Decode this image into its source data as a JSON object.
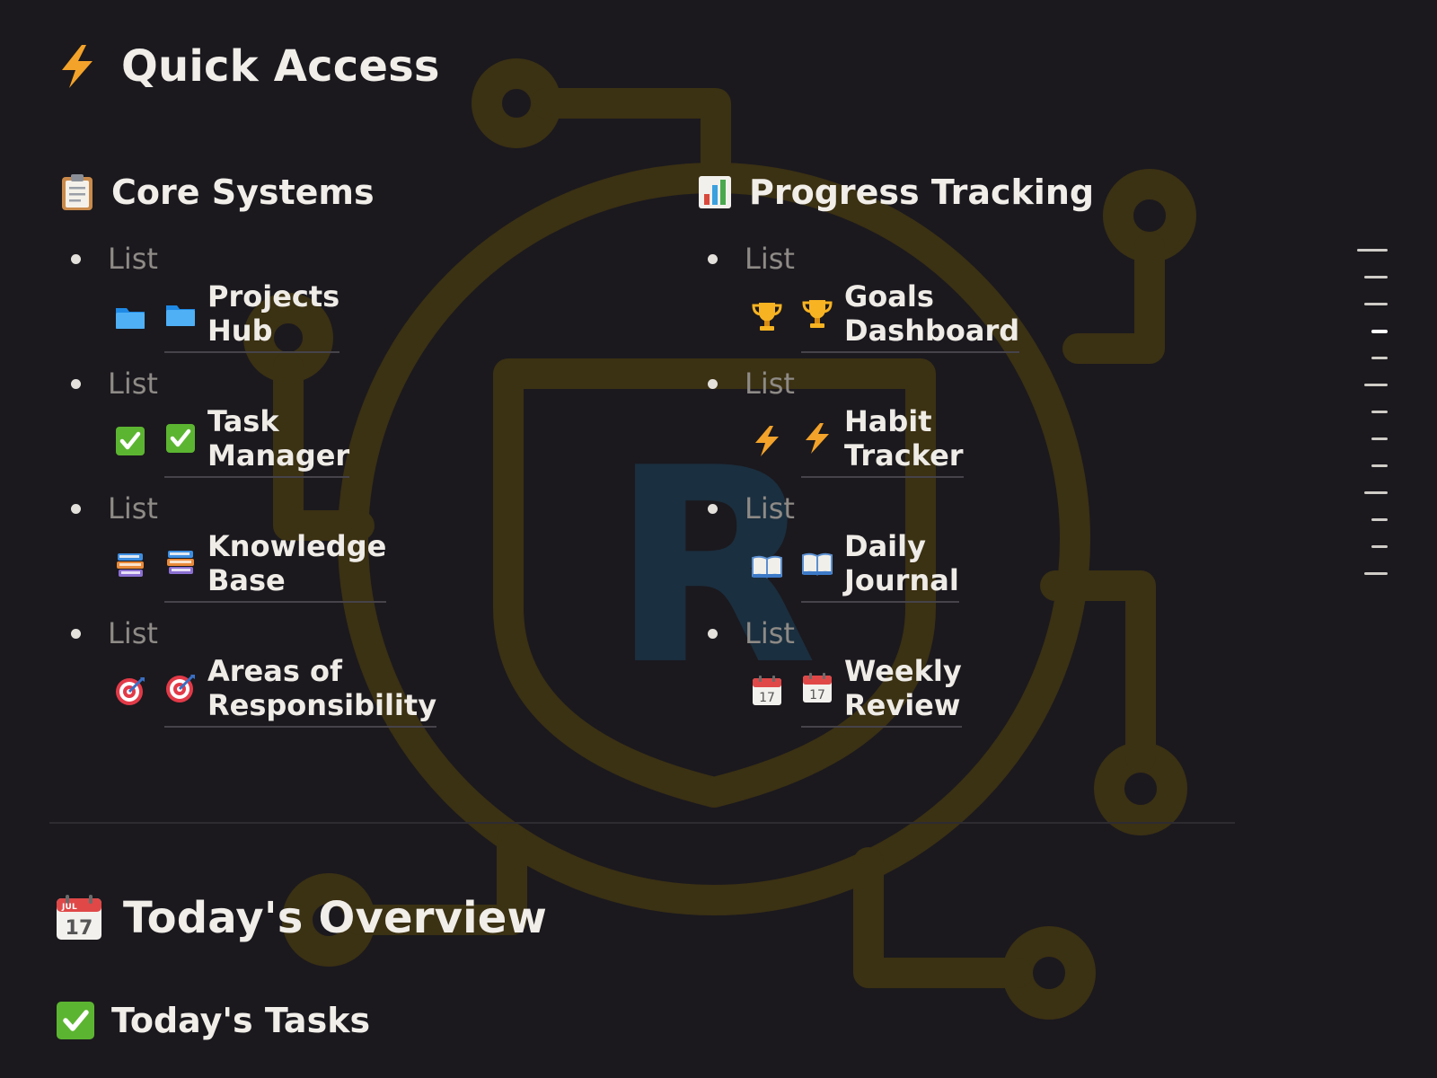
{
  "colors": {
    "background": "#1b191e",
    "logo_gold": "#3b3113",
    "logo_letter": "#1a2f3f",
    "text": "#efece7",
    "muted": "#8e8a86"
  },
  "quick_access": {
    "icon": "lightning-icon",
    "title": "Quick Access"
  },
  "core_systems": {
    "icon": "clipboard-icon",
    "title": "Core Systems",
    "items": [
      {
        "bullet_label": "List",
        "icon": "folder-icon",
        "label": "Projects Hub"
      },
      {
        "bullet_label": "List",
        "icon": "checkmark-icon",
        "label": "Task Manager"
      },
      {
        "bullet_label": "List",
        "icon": "books-icon",
        "label": "Knowledge Base"
      },
      {
        "bullet_label": "List",
        "icon": "target-icon",
        "label": "Areas of Responsibility"
      }
    ]
  },
  "progress_tracking": {
    "icon": "bar-chart-icon",
    "title": "Progress Tracking",
    "items": [
      {
        "bullet_label": "List",
        "icon": "trophy-icon",
        "label": "Goals Dashboard"
      },
      {
        "bullet_label": "List",
        "icon": "lightning-icon",
        "label": "Habit Tracker"
      },
      {
        "bullet_label": "List",
        "icon": "open-book-icon",
        "label": "Daily Journal"
      },
      {
        "bullet_label": "List",
        "icon": "calendar-icon",
        "label": "Weekly Review"
      }
    ]
  },
  "todays_overview": {
    "icon": "calendar-icon",
    "title": "Today's Overview",
    "calendar_month": "JUL",
    "calendar_day": "17"
  },
  "todays_tasks": {
    "icon": "checkmark-icon",
    "title": "Today's Tasks"
  },
  "background_logo": {
    "letter": "R"
  }
}
